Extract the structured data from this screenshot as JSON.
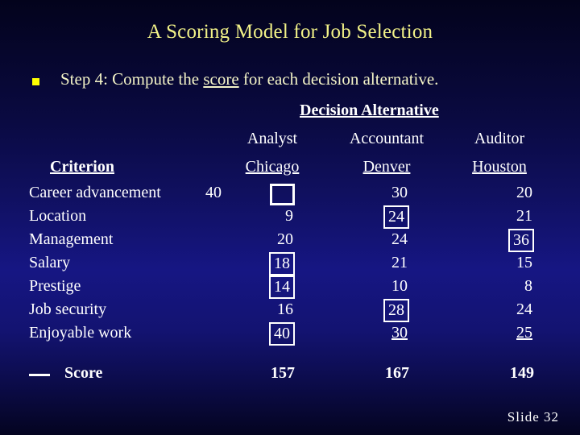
{
  "slide": {
    "title": "A Scoring Model for Job Selection",
    "bullet": {
      "marker": "square-bullet",
      "text_before": "Step 4:  Compute the ",
      "text_underlined": "score",
      "text_after": " for each decision alternative."
    },
    "slide_number_label": "Slide  32"
  },
  "table": {
    "group_header": "Decision Alternative",
    "criterion_header": "Criterion",
    "alternatives": [
      {
        "name": "Analyst",
        "city": "Chicago"
      },
      {
        "name": "Accountant",
        "city": "Denver"
      },
      {
        "name": "Auditor",
        "city": "Houston"
      }
    ],
    "rows": [
      {
        "criterion": "Career advancement",
        "weight": "40",
        "cells": [
          {
            "value": "",
            "boxed": true,
            "underlined": false,
            "empty_box": true
          },
          {
            "value": "30",
            "boxed": false,
            "underlined": false,
            "empty_box": false
          },
          {
            "value": "20",
            "boxed": false,
            "underlined": false,
            "empty_box": false
          }
        ]
      },
      {
        "criterion": "Location",
        "weight": "",
        "cells": [
          {
            "value": "9",
            "boxed": false,
            "underlined": false,
            "empty_box": false
          },
          {
            "value": "24",
            "boxed": true,
            "underlined": false,
            "empty_box": false
          },
          {
            "value": "21",
            "boxed": false,
            "underlined": false,
            "empty_box": false
          }
        ]
      },
      {
        "criterion": "Management",
        "weight": "",
        "cells": [
          {
            "value": "20",
            "boxed": false,
            "underlined": false,
            "empty_box": false
          },
          {
            "value": "24",
            "boxed": false,
            "underlined": false,
            "empty_box": false
          },
          {
            "value": "36",
            "boxed": true,
            "underlined": false,
            "empty_box": false
          }
        ]
      },
      {
        "criterion": "Salary",
        "weight": "",
        "cells": [
          {
            "value": "18",
            "boxed": true,
            "underlined": false,
            "empty_box": false
          },
          {
            "value": "21",
            "boxed": false,
            "underlined": false,
            "empty_box": false
          },
          {
            "value": "15",
            "boxed": false,
            "underlined": false,
            "empty_box": false
          }
        ]
      },
      {
        "criterion": "Prestige",
        "weight": "",
        "cells": [
          {
            "value": "14",
            "boxed": true,
            "underlined": false,
            "empty_box": false
          },
          {
            "value": "10",
            "boxed": false,
            "underlined": false,
            "empty_box": false
          },
          {
            "value": "8",
            "boxed": false,
            "underlined": false,
            "empty_box": false
          }
        ]
      },
      {
        "criterion": "Job security",
        "weight": "",
        "cells": [
          {
            "value": "16",
            "boxed": false,
            "underlined": false,
            "empty_box": false
          },
          {
            "value": "28",
            "boxed": true,
            "underlined": false,
            "empty_box": false
          },
          {
            "value": "24",
            "boxed": false,
            "underlined": false,
            "empty_box": false
          }
        ]
      },
      {
        "criterion": "Enjoyable work",
        "weight": "",
        "cells": [
          {
            "value": "40",
            "boxed": true,
            "underlined": false,
            "empty_box": false
          },
          {
            "value": "30",
            "boxed": false,
            "underlined": true,
            "empty_box": false
          },
          {
            "value": "25",
            "boxed": false,
            "underlined": true,
            "empty_box": false
          }
        ]
      }
    ],
    "score_row": {
      "label": "Score",
      "values": [
        "157",
        "167",
        "149"
      ]
    }
  },
  "colors": {
    "title_text": "#f2f288",
    "body_text": "#f5f5c8",
    "table_text": "#ffffff",
    "bullet_marker": "#ffff00",
    "background_top": "#03031c",
    "background_mid": "#161683",
    "background_bottom": "#040420"
  }
}
